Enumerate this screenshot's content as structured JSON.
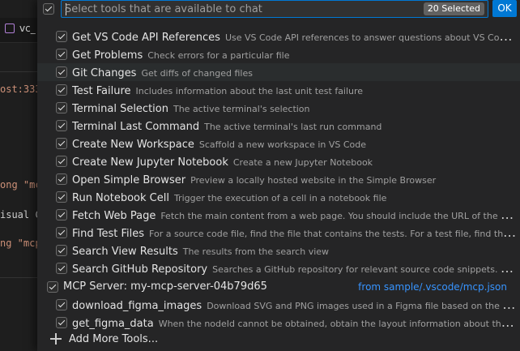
{
  "background": {
    "tab_label": "vc_",
    "code_lines": [
      "ost:333",
      "ong \"mc",
      "isual C",
      "ng \"mcp"
    ]
  },
  "header": {
    "placeholder": "Select tools that are available to chat",
    "selected_count": "20 Selected",
    "ok_label": "OK"
  },
  "tools": [
    {
      "name": "Get VS Code API References",
      "description": "Use VS Code API references to answer questions about VS Code extension development."
    },
    {
      "name": "Get Problems",
      "description": "Check errors for a particular file"
    },
    {
      "name": "Git Changes",
      "description": "Get diffs of changed files"
    },
    {
      "name": "Test Failure",
      "description": "Includes information about the last unit test failure"
    },
    {
      "name": "Terminal Selection",
      "description": "The active terminal's selection"
    },
    {
      "name": "Terminal Last Command",
      "description": "The active terminal's last run command"
    },
    {
      "name": "Create New Workspace",
      "description": "Scaffold a new workspace in VS Code"
    },
    {
      "name": "Create New Jupyter Notebook",
      "description": "Create a new Jupyter Notebook"
    },
    {
      "name": "Open Simple Browser",
      "description": "Preview a locally hosted website in the Simple Browser"
    },
    {
      "name": "Run Notebook Cell",
      "description": "Trigger the execution of a cell in a notebook file"
    },
    {
      "name": "Fetch Web Page",
      "description": "Fetch the main content from a web page. You should include the URL of the page you want to fetch."
    },
    {
      "name": "Find Test Files",
      "description": "For a source code file, find the file that contains the tests. For a test file, find the file that contains the code under test."
    },
    {
      "name": "Search View Results",
      "description": "The results from the search view"
    },
    {
      "name": "Search GitHub Repository",
      "description": "Searches a GitHub repository for relevant source code snippets. You can specify a repository."
    }
  ],
  "mcp_server": {
    "label": "MCP Server: my-mcp-server-04b79d65",
    "source": "from sample/.vscode/mcp.json",
    "tools": [
      {
        "name": "download_figma_images",
        "description": "Download SVG and PNG images used in a Figma file based on the IDs of image or icon nodes"
      },
      {
        "name": "get_figma_data",
        "description": "When the nodeId cannot be obtained, obtain the layout information about the entire Figma file"
      }
    ]
  },
  "add_more_label": "Add More Tools..."
}
